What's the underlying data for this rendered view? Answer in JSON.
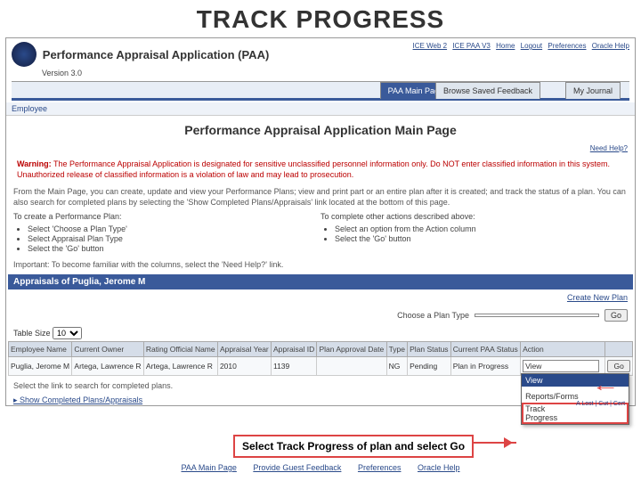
{
  "slide_title": "TRACK PROGRESS",
  "header": {
    "app_title": "Performance Appraisal Application (PAA)",
    "version": "Version 3.0",
    "links": [
      "ICE Web 2",
      "ICE PAA V3",
      "Home",
      "Logout",
      "Preferences",
      "Oracle Help"
    ]
  },
  "tabs": {
    "active": "PAA Main Page",
    "t2": "Browse Saved Feedback",
    "t3": "My Journal"
  },
  "sub_employee": "Employee",
  "main_title": "Performance Appraisal Application Main Page",
  "need_help": "Need Help?",
  "warning_label": "Warning:",
  "warning_text": "The Performance Appraisal Application is designated for sensitive unclassified personnel information only. Do NOT enter classified information in this system. Unauthorized release of classified information is a violation of law and may lead to prosecution.",
  "intro": "From the Main Page, you can create, update and view your Performance Plans; view and print part or an entire plan after it is created; and track the status of a plan. You can also search for completed plans by selecting the 'Show Completed Plans/Appraisals' link located at the bottom of this page.",
  "col1_head": "To create a Performance Plan:",
  "col1_items": [
    "Select 'Choose a Plan Type'",
    "Select Appraisal Plan Type",
    "Select the 'Go' button"
  ],
  "col2_head": "To complete other actions described above:",
  "col2_items": [
    "Select an option from the Action column",
    "Select the 'Go' button"
  ],
  "important": "Important: To become familiar with the columns, select the 'Need Help?' link.",
  "section_title": "Appraisals of Puglia, Jerome M",
  "create_new": "Create New Plan",
  "choose_lbl": "Choose a Plan Type",
  "dd_placeholder": "",
  "go": "Go",
  "table_size_lbl": "Table Size",
  "table_size_val": "10",
  "columns": [
    "Employee Name",
    "Current Owner",
    "Rating Official Name",
    "Appraisal Year",
    "Appraisal ID",
    "Plan Approval Date",
    "Type",
    "Plan Status",
    "Current PAA Status",
    "Action"
  ],
  "row": {
    "emp": "Puglia, Jerome M",
    "owner": "Artega, Lawrence R",
    "ro": "Artega, Lawrence R",
    "year": "2010",
    "id": "1139",
    "approval": "",
    "type": "NG",
    "status": "Pending",
    "paa": "Plan in Progress",
    "action": "View"
  },
  "dropdown_items": [
    "View",
    "",
    "Reports/Forms",
    "Track Progress"
  ],
  "dropdown_aside": "A Lost | Cut | Cert",
  "footer_note": "Select the link to search for completed plans.",
  "footer_link": "Show Completed Plans/Appraisals",
  "bottom_links": [
    "PAA Main Page",
    "Provide Guest Feedback",
    "Preferences",
    "Oracle Help"
  ],
  "callout": "Select Track Progress of plan and select Go"
}
